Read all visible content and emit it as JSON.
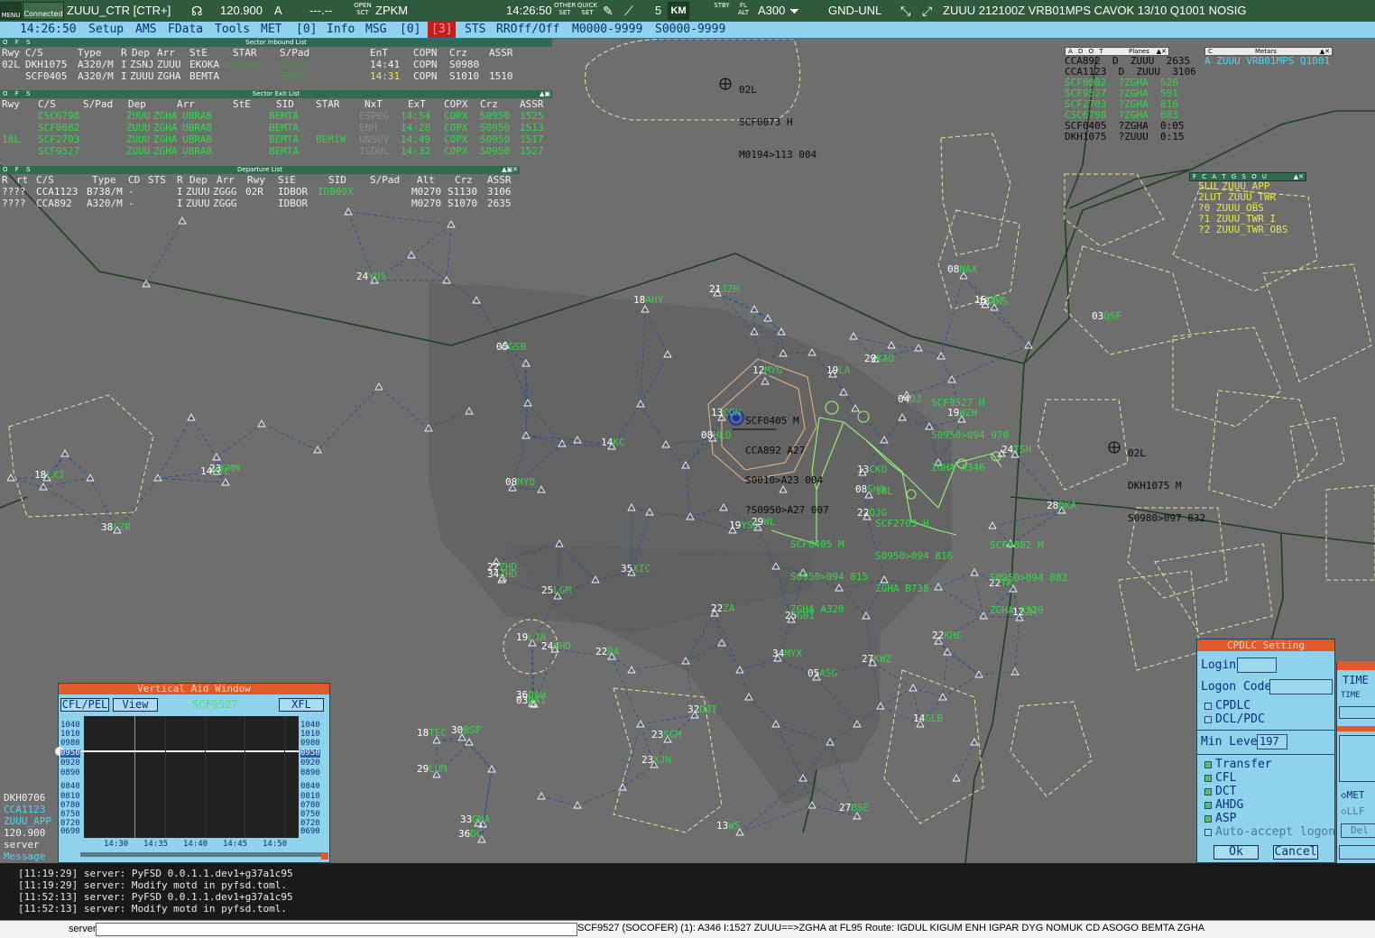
{
  "topbar": {
    "menu_label": "MENU",
    "connected_label": "Connected",
    "callsign": "ZUUU_CTR [CTR+]",
    "frequency": "120.900",
    "freq_mode": "A",
    "freq_standby": "---.--",
    "open_sct_label": "OPEN SCT",
    "airport": "ZPKM",
    "clock": "14:26:50",
    "other_set_label": "OTHER SET",
    "quick_set_label": "QUICK SET",
    "range_value": "5",
    "unit_label": "KM",
    "stby_label": "STBY",
    "fl_alt_label": "FL ALT",
    "aircraft_type": "A300",
    "level_filter": "GND-UNL",
    "metar": "ZUUU 212100Z VRB01MPS CAVOK 13/10 Q1001 NOSIG"
  },
  "menubar": {
    "clock": "14:26:50",
    "items": [
      "Setup",
      "AMS",
      "FData",
      "Tools",
      "MET",
      "[0]",
      "Info",
      "MSG",
      "[0]",
      "[3]",
      "STS",
      "RROff/Off",
      "M0000-9999",
      "S0000-9999"
    ]
  },
  "inbound_list": {
    "title": "Sector Inbound List",
    "ofs": "O F S",
    "headers": [
      "Rwy",
      "C/S",
      "Type",
      "R",
      "Dep",
      "Arr",
      "StE",
      "STAR",
      "S/Pad",
      "EnT",
      "COPN",
      "Crz",
      "ASSR"
    ],
    "rows": [
      [
        "02L",
        "DKH1075",
        "A320/M",
        "I",
        "ZSNJ",
        "ZUUU",
        "EKOKA",
        "EKOK8J",
        "POVUN",
        "14:41",
        "COPN",
        "S0980",
        ""
      ],
      [
        "",
        "SCF0405",
        "A320/M",
        "I",
        "ZUUU",
        "ZGHA",
        "BEMTA",
        "",
        "UBRAS",
        "14:31",
        "COPN",
        "S1010",
        "1510"
      ]
    ]
  },
  "exit_list": {
    "title": "Sector Exit List",
    "ofs": "O F S",
    "headers": [
      "Rwy",
      "C/S",
      "S/Pad",
      "Dep",
      "Arr",
      "StE",
      "SID",
      "STAR",
      "NxT",
      "ExT",
      "COPX",
      "Crz",
      "ASSR"
    ],
    "rows": [
      [
        "",
        "CSC6798",
        "",
        "ZUUU",
        "ZGHA",
        "UBRAB",
        "",
        "BEMTA",
        "",
        "ESPEG",
        "14:54",
        "COPX",
        "S0950",
        "1525"
      ],
      [
        "",
        "SCF0082",
        "",
        "ZUUU",
        "ZGHA",
        "UBRAB",
        "",
        "BEMTA",
        "",
        "ENH",
        "14:28",
        "COPX",
        "S0950",
        "1513"
      ],
      [
        "18L",
        "SCF2703",
        "",
        "ZUUU",
        "ZGHA",
        "UBRAB",
        "",
        "BEMTA",
        "BEM1W",
        "UNSUV",
        "14:49",
        "COPX",
        "S0950",
        "1517"
      ],
      [
        "",
        "SCF9527",
        "",
        "ZUUU",
        "ZGHA",
        "UBRAB",
        "",
        "BEMTA",
        "",
        "IGDUL",
        "14:32",
        "COPX",
        "S0950",
        "1527"
      ]
    ]
  },
  "departure_list": {
    "title": "Departure List",
    "ofs": "O F S",
    "headers": [
      "R",
      "rt",
      "C/S",
      "Type",
      "CD",
      "STS",
      "R",
      "Dep",
      "Arr",
      "Rwy",
      "SiE",
      "SID",
      "S/Pad",
      "Alt",
      "Crz",
      "ASSR"
    ],
    "rows": [
      [
        "????",
        "CCA1123",
        "B738/M",
        "-",
        "I",
        "ZUUU",
        "ZGGG",
        "02R",
        "IDBOR",
        "IDB09X",
        "M0270",
        "S1130",
        "3106"
      ],
      [
        "????",
        "CCA892",
        "A320/M",
        "-",
        "I",
        "ZUUU",
        "ZGGG",
        "",
        "IDBOR",
        "",
        "M0270",
        "S1070",
        "2635"
      ]
    ]
  },
  "planes_popup": {
    "title": "Planes",
    "flags": "A D O T",
    "rows": [
      [
        "CCA892",
        "D",
        "ZUUU",
        "2635"
      ],
      [
        "CCA1123",
        "D",
        "ZUUU",
        "3106"
      ],
      [
        "SCF0082",
        "?ZGHA",
        "526",
        ""
      ],
      [
        "SCF9527",
        "?ZGHA",
        "591",
        ""
      ],
      [
        "SCF2703",
        "?ZGHA",
        "816",
        ""
      ],
      [
        "CSC6798",
        "?ZGHA",
        "883",
        ""
      ],
      [
        "SCF0405",
        "?ZGHA",
        "0:05",
        ""
      ],
      [
        "DKH1075",
        "?ZUUU",
        "0:15",
        ""
      ]
    ]
  },
  "metars_popup": {
    "title": "Metars",
    "flag": "C",
    "text": "A ZUUU VRB01MPS Q1001"
  },
  "atc_popup": {
    "flags": "F C A T G S O U",
    "rows": [
      "5LU ZUUU_APP",
      "2LUT ZUUU_TWR",
      "?0 ZUUU_OBS",
      "?1 ZUUU_TWR_I",
      "?2 ZUUU_TWR_OBS"
    ]
  },
  "tags": [
    {
      "id": "t1",
      "lines": [
        "02L",
        "SCF0073 H",
        "M0194>113 004"
      ]
    },
    {
      "id": "t2",
      "lines": [
        "SCF9527 H",
        "S0950>094 970",
        "ZGHA A346"
      ]
    },
    {
      "id": "t3",
      "lines": [
        "02L",
        "DKH1075 M",
        "S0980>097 832"
      ]
    },
    {
      "id": "t4",
      "lines": [
        "SCF0082 M",
        "S0950>094 882",
        "ZGHA A320"
      ]
    },
    {
      "id": "t5",
      "lines": [
        "SCF0405 M",
        "S0950>094 815",
        "ZGHA A320"
      ]
    },
    {
      "id": "t6",
      "lines": [
        "18L",
        "SCF2703 H",
        "S0950>094 816",
        "ZGHA B738"
      ]
    },
    {
      "id": "t7",
      "lines": [
        "SCF0405 M",
        "CCA892 A27",
        "S0010>A23 004",
        "?S0950>A27 007"
      ]
    }
  ],
  "fixes": [
    [
      "05",
      "GSB"
    ],
    [
      "24",
      "YUS"
    ],
    [
      "21",
      "JZH"
    ],
    [
      "18",
      "AHY"
    ],
    [
      "12",
      "MYG"
    ],
    [
      "19",
      "LA"
    ],
    [
      "29",
      "KAD"
    ],
    [
      "08",
      "HLO"
    ],
    [
      "04",
      "DJ"
    ],
    [
      "19",
      "WZH"
    ],
    [
      "14",
      "KC"
    ],
    [
      "13",
      "CKO"
    ],
    [
      "08",
      "SHO"
    ],
    [
      "08",
      "MYO"
    ],
    [
      "22",
      "QJG"
    ],
    [
      "29",
      "WL"
    ],
    [
      "19",
      "YSC"
    ],
    [
      "34",
      "ZHD"
    ],
    [
      "35",
      "XIC"
    ],
    [
      "25",
      "LGM"
    ],
    [
      "22",
      "ZA"
    ],
    [
      "25",
      "GBI"
    ],
    [
      "22",
      "PA"
    ],
    [
      "34",
      "MYX"
    ],
    [
      "05",
      "ASG"
    ],
    [
      "27",
      "KWZ"
    ],
    [
      "22",
      "KHE"
    ],
    [
      "22",
      "TR"
    ],
    [
      "12",
      "ZH"
    ],
    [
      "03",
      "DAI"
    ],
    [
      "32",
      "DJT"
    ],
    [
      "23",
      "SGM"
    ],
    [
      "23",
      "XJN"
    ],
    [
      "18",
      "TEC"
    ],
    [
      "30",
      "BSP"
    ],
    [
      "29",
      "LUM"
    ],
    [
      "33",
      "GMA"
    ],
    [
      "36",
      "DC"
    ],
    [
      "13",
      "WS"
    ],
    [
      "27",
      "BSE"
    ],
    [
      "14",
      "GLB"
    ],
    [
      "18",
      "AKS"
    ],
    [
      "24",
      "TSH"
    ],
    [
      "22",
      "ZHD"
    ],
    [
      "18",
      "LXJ"
    ],
    [
      "14",
      "MIL"
    ],
    [
      "23",
      "GMM"
    ],
    [
      "38",
      "LZR"
    ],
    [
      "28",
      "DKA"
    ],
    [
      "19",
      "LJA"
    ],
    [
      "24",
      "CHD"
    ],
    [
      "36",
      "DAH"
    ],
    [
      "08",
      "NAX"
    ],
    [
      "03",
      "QSF"
    ],
    [
      "13",
      "CON"
    ],
    [
      "15",
      "LAY"
    ]
  ],
  "bottom_left": {
    "lines": [
      "DKH0706",
      "CCA1123",
      "ZUUU_APP",
      "120.900",
      "server",
      "Message"
    ]
  },
  "vaw": {
    "title": "Vertical Aid Window",
    "btn_cfl": "CFL/PEL",
    "btn_view": "View",
    "callsign": "SCF9527",
    "btn_xfl": "XFL",
    "levels": [
      "1040",
      "1010",
      "0980",
      "0950",
      "0920",
      "0890",
      "0840",
      "0810",
      "0780",
      "0750",
      "0720",
      "0690"
    ],
    "times": [
      "14:30",
      "14:35",
      "14:40",
      "14:45",
      "14:50"
    ]
  },
  "cpdlc": {
    "title": "CPDLC Setting",
    "login_label": "Login",
    "logon_code_label": "Logon Code",
    "cpdlc_label": "CPDLC",
    "dcl_label": "DCL/PDC",
    "min_level_label": "Min Level",
    "min_level_value": "197",
    "options": [
      "Transfer",
      "CFL",
      "DCT",
      "AHDG",
      "ASP",
      "Auto-accept logon"
    ],
    "ok": "Ok",
    "cancel": "Cancel"
  },
  "right_edge": {
    "time_header": "TIME",
    "time_col": "TIME",
    "options": [
      "MET",
      "LLF"
    ],
    "del_label": "Del"
  },
  "messages": [
    "[11:19:29] server: PyFSD 0.0.1.1.dev1+g37a1c95",
    "[11:19:29] server: Modify motd in pyfsd.toml.",
    "[11:52:13] server: PyFSD 0.0.1.1.dev1+g37a1c95",
    "[11:52:13] server: Modify motd in pyfsd.toml."
  ],
  "status": {
    "prompt": "server",
    "flightplan": "SCF9527 (SOCOFER) (1): A346 I:1527 ZUUU==>ZGHA at FL95 Route: IGDUL KIGUM ENH IGPAR DYG NOMUK CD ASOGO BEMTA ZGHA"
  },
  "colors": {
    "background": "#6e6e6e",
    "toolbar": "#2f5a3c",
    "menubar": "#8fd2ec",
    "label_green": "#33d94a",
    "fix_green": "#37d24a",
    "airway_blue": "#2d4f8a",
    "sector_line": "#1e4020",
    "dialog_title": "#e05a2a"
  }
}
